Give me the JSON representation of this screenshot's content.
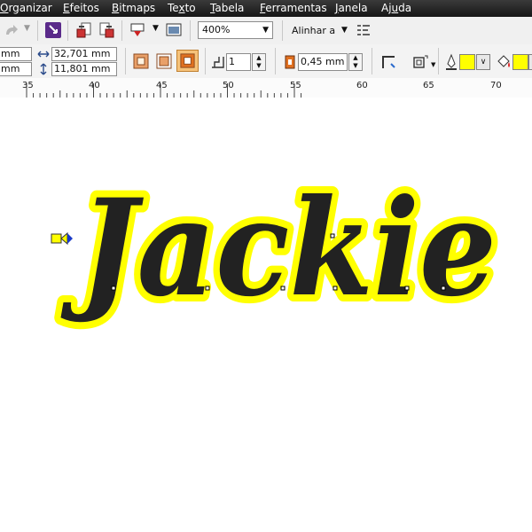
{
  "menu": [
    {
      "label": "Organizar",
      "mnemonic": "O",
      "rest": "rganizar"
    },
    {
      "label": "Efeitos",
      "mnemonic": "E",
      "rest": "feitos"
    },
    {
      "label": "Bitmaps",
      "mnemonic": "B",
      "rest": "itmaps"
    },
    {
      "label": "Texto",
      "pre": "Te",
      "mnemonic": "x",
      "rest": "to"
    },
    {
      "label": "Tabela",
      "mnemonic": "T",
      "rest": "abela"
    },
    {
      "label": "Ferramentas",
      "mnemonic": "F",
      "rest": "erramentas"
    },
    {
      "label": "Janela",
      "mnemonic": "J",
      "rest": "anela"
    },
    {
      "label": "Ajuda",
      "pre": "Aj",
      "mnemonic": "u",
      "rest": "da"
    }
  ],
  "toolbar": {
    "zoom_value": "400%",
    "align_label": "Alinhar a"
  },
  "property_bar": {
    "pos_x_unit": "mm",
    "pos_y_unit": "mm",
    "width_value": "32,701 mm",
    "height_value": "11,801 mm",
    "steps_value": "1",
    "outline_width_value": "0,45 mm",
    "outline_color": "#ffff00",
    "fill_color": "#ffff00"
  },
  "ruler": {
    "labels": [
      "35",
      "40",
      "45",
      "50",
      "55",
      "60",
      "65",
      "70"
    ]
  },
  "canvas": {
    "text": "Jackie",
    "text_color": "#222222",
    "contour_color": "#ffff00"
  }
}
